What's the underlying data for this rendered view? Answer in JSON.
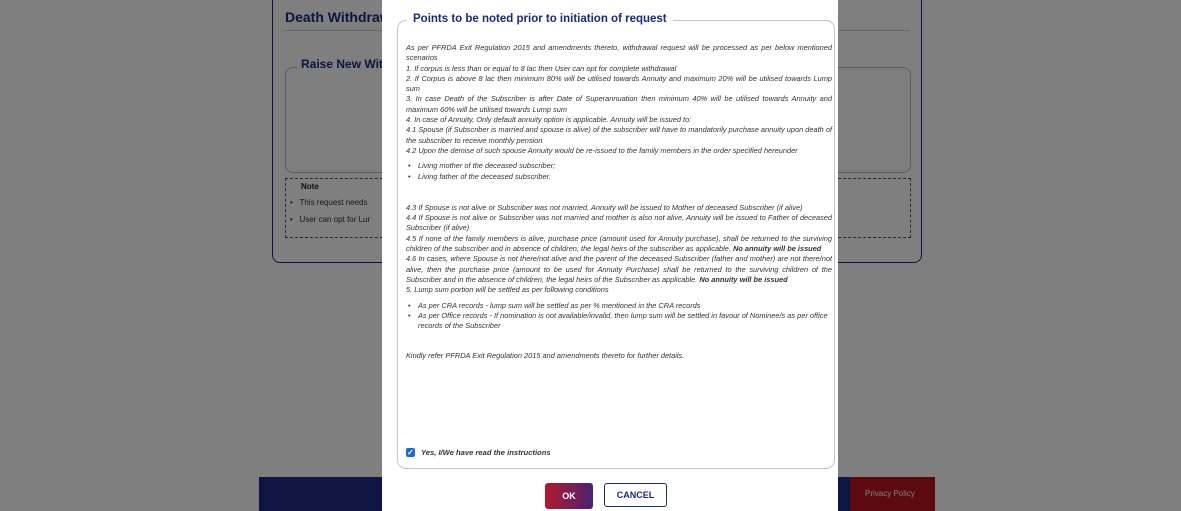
{
  "background": {
    "page_title": "Death Withdraw",
    "raise_section_label": "Raise New Withd",
    "note": {
      "title": "Note",
      "items": [
        "This request needs",
        "User can opt for Lur"
      ]
    },
    "footer_link": "Privacy Policy"
  },
  "modal": {
    "legend": "Points to be noted prior to initiation of request",
    "intro": "As per PFRDA Exit Regulation 2015 and amendments thereto, withdrawal request will be processed as per below mentioned scenarios",
    "points": [
      "1. If corpus is less than or equal to 8 lac then User can opt for complete withdrawal",
      "2. If Corpus is above 8 lac then minimum 80% will be utilised towards Annuity and maximum 20% will be utilised towards Lump sum",
      "3. In case Death of the Subscriber is after Date of Superannuation then minimum 40% will be utilised towards Annuity and maximum 60% will be utilised towards Lump sum",
      "4. In case of Annuity, Only default annuity option is applicable. Annuity will be issued to:",
      "4.1 Spouse (if Subscriber is married and spouse is alive) of the subscriber will have to mandatorily purchase annuity upon death of the subscriber to receive monthly pension",
      "4.2 Upon the demise of such spouse Annuity would be re-issued to the family members in the order specified hereunder"
    ],
    "family_list": [
      "Living mother of the deceased subscriber;",
      "Living father of the deceased subscriber."
    ],
    "point_4_3": "4.3 If Spouse is not alive or Subscriber was not married, Annuity will be issued to Mother of deceased Subscriber (if alive)",
    "point_4_4": "4.4 If Spouse is not alive or Subscriber was not married and mother is also not alive, Annuity will be issued to Father of deceased Subscriber (if alive)",
    "point_4_5": "4.5 If none of the family members is alive, purchase price (amount used for Annuity purchase), shall be returned to the surviving children of the subscriber and in absence of children, the legal heirs of the subscriber as applicable. ",
    "point_4_6": "4.6 In cases, where Spouse is not there/not alive and the parent of the deceased Subscriber (father and mother) are not there/not alive, then the purchase price (amount to be used for Annuity Purchase) shall be returned to the surviving children of the Subscriber and in the absence of children, the legal heirs of the Subscriber as applicable. ",
    "no_annuity": "No annuity will be issued",
    "point_5": "5. Lump sum portion will be settled as per following conditions",
    "lumpsum_list": [
      "As per CRA records - lump sum will be settled as per % mentioned in the CRA records",
      "As per Office records - If nomination is not available/invalid, then lump sum will be settled in favour of Nominee/s as per office records of the Subscriber"
    ],
    "refer_text": "Kindly refer PFRDA Exit Regulation 2015 and amendments thereto for further details.",
    "acknowledgement": "Yes, I/We have read the instructions",
    "ok_label": "OK",
    "cancel_label": "CANCEL"
  }
}
